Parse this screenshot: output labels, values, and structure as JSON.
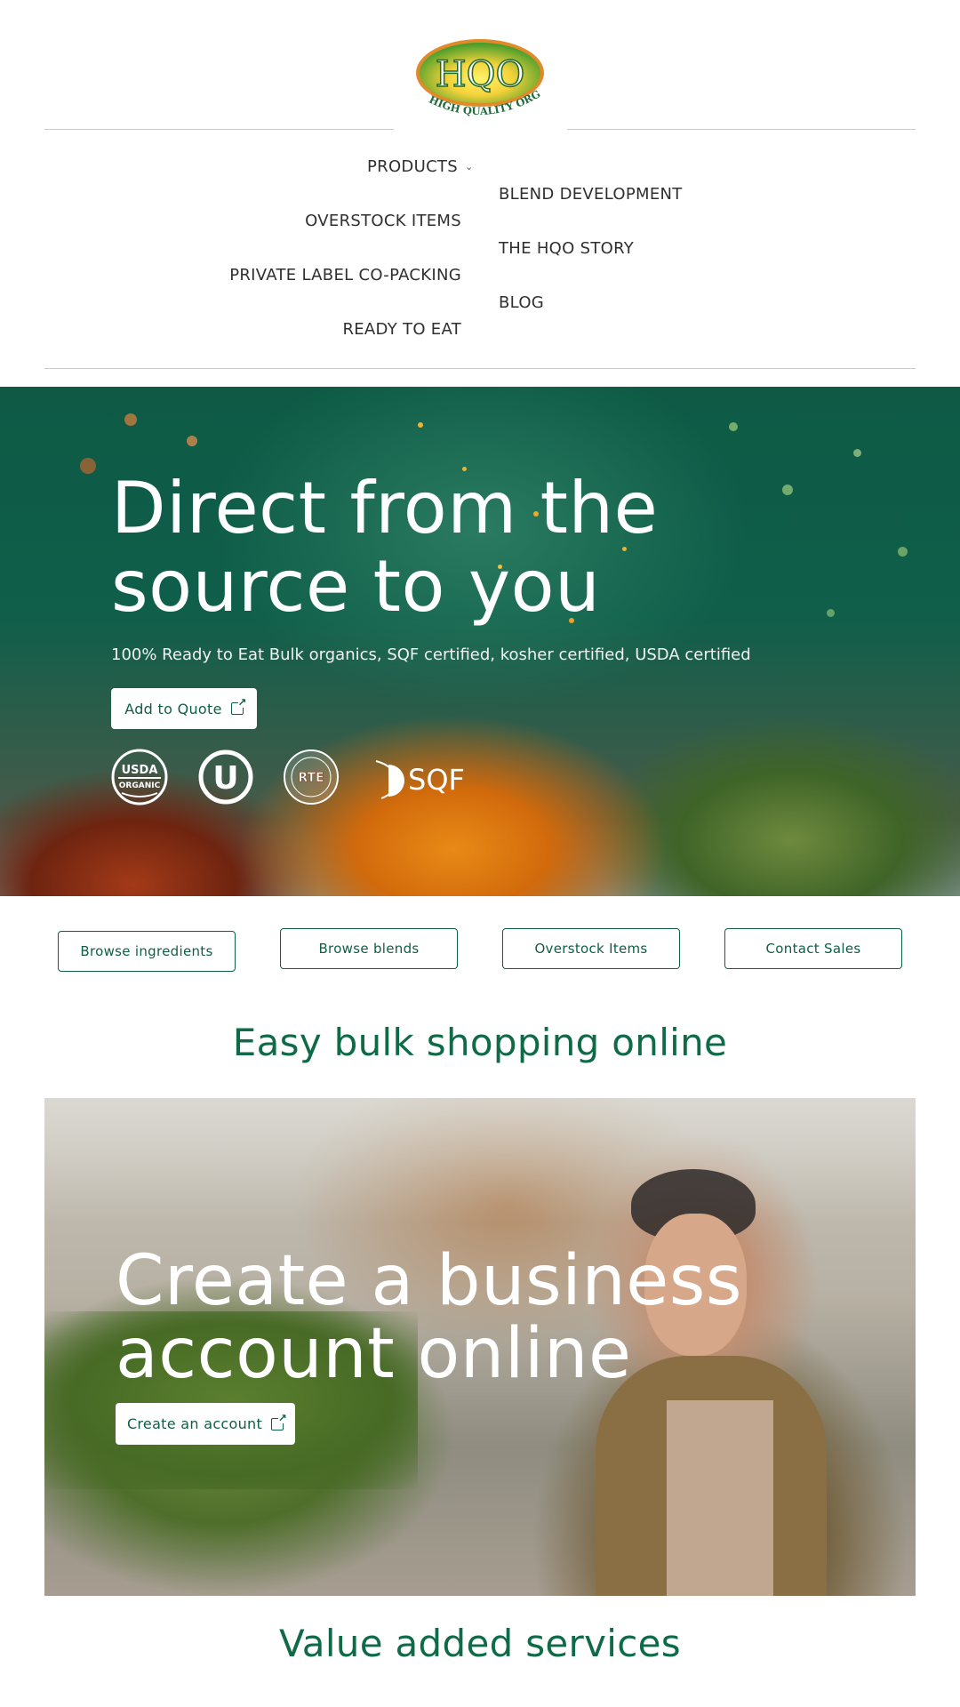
{
  "header": {
    "logo": {
      "main": "HQO",
      "tagline": "HIGH QUALITY ORGANICS",
      "tm": "™"
    },
    "nav": {
      "left": [
        {
          "label": "PRODUCTS",
          "has_dropdown": true
        },
        {
          "label": "OVERSTOCK ITEMS"
        },
        {
          "label": "PRIVATE LABEL CO-PACKING"
        },
        {
          "label": "READY TO EAT"
        }
      ],
      "right": [
        {
          "label": "BLEND DEVELOPMENT"
        },
        {
          "label": "THE HQO STORY"
        },
        {
          "label": "BLOG"
        }
      ],
      "dropdown_icon": "chevron-down-icon"
    }
  },
  "hero": {
    "title_line1": "Direct from the",
    "title_line2": "source to you",
    "subtitle": "100% Ready to Eat Bulk organics, SQF certified, kosher certified, USDA certified",
    "cta_label": "Add to Quote",
    "cta_icon": "external-link-icon",
    "certifications": [
      {
        "name": "USDA Organic",
        "top": "USDA",
        "bottom": "ORGANIC"
      },
      {
        "name": "OU Kosher",
        "glyph": "U"
      },
      {
        "name": "RTE",
        "label": "RTE"
      },
      {
        "name": "SQF",
        "label": "SQF"
      }
    ]
  },
  "quick_links": [
    {
      "label": "Browse ingredients"
    },
    {
      "label": "Browse blends"
    },
    {
      "label": "Overstock Items"
    },
    {
      "label": "Contact Sales"
    }
  ],
  "sections": {
    "easy_bulk": {
      "title": "Easy bulk shopping online"
    },
    "business_banner": {
      "title_line1": "Create a business",
      "title_line2": "account online",
      "cta_label": "Create an account",
      "cta_icon": "external-link-icon"
    },
    "value_added": {
      "title": "Value added services"
    }
  },
  "colors": {
    "brand_green": "#0f5e46",
    "heading_green": "#0f6a48",
    "nav_text": "#2f2f2f"
  }
}
